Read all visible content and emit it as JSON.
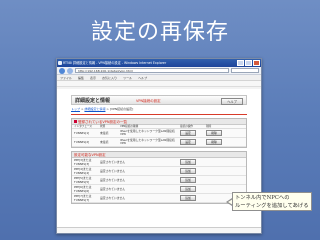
{
  "slide": {
    "title": "設定の再保存"
  },
  "browser": {
    "title": "RT58i 詳細設定と情報 - VPN接続の設定 - Windows Internet Explorer",
    "url": "http://192.168.100.1/detail/vpn.html",
    "menu": [
      "ファイル",
      "編集",
      "表示",
      "お気に入り",
      "ツール",
      "ヘルプ"
    ]
  },
  "page": {
    "header_title": "詳細設定と情報",
    "header_sub": "VPN接続の設定",
    "help_label": "ヘルプ",
    "breadcrumb_links": [
      "トップ",
      "詳細設定と情報"
    ],
    "breadcrumb_current": "> [VPN接続の設定]",
    "registered": {
      "title": "登録されているVPN設定の一覧",
      "columns": [
        "インタフェース",
        "状態",
        "VPN接続の種類",
        "接続の操作",
        "削除"
      ],
      "rows": [
        {
          "iface": "TUNNEL[1]",
          "status": "未接続",
          "type": "IPsecを使用したネットワーク型LAN間接続VPN",
          "edit": "設定",
          "del": "削除"
        },
        {
          "iface": "TUNNEL[2]",
          "status": "未接続",
          "type": "IPsecを使用したネットワーク型LAN間接続VPN",
          "edit": "設定",
          "del": "削除"
        }
      ]
    },
    "available": {
      "title": "設定可能なVPN設定",
      "rows": [
        {
          "iface": "PPP[3]または TUNNEL[3]",
          "status": "設定されていません",
          "action": "追加"
        },
        {
          "iface": "PPP[4]または TUNNEL[4]",
          "status": "設定されていません",
          "action": "追加"
        },
        {
          "iface": "PPP[5]または TUNNEL[5]",
          "status": "設定されていません",
          "action": "追加"
        },
        {
          "iface": "PPP[6]または TUNNEL[6]",
          "status": "設定されていません",
          "action": "追加"
        },
        {
          "iface": "PPP[7]または TUNNEL[7]",
          "status": "設定されていません",
          "action": "追加"
        }
      ]
    }
  },
  "callout": {
    "line1": "トンネル内でNPCへの",
    "line2": "ルーティングを追加してあげる"
  }
}
